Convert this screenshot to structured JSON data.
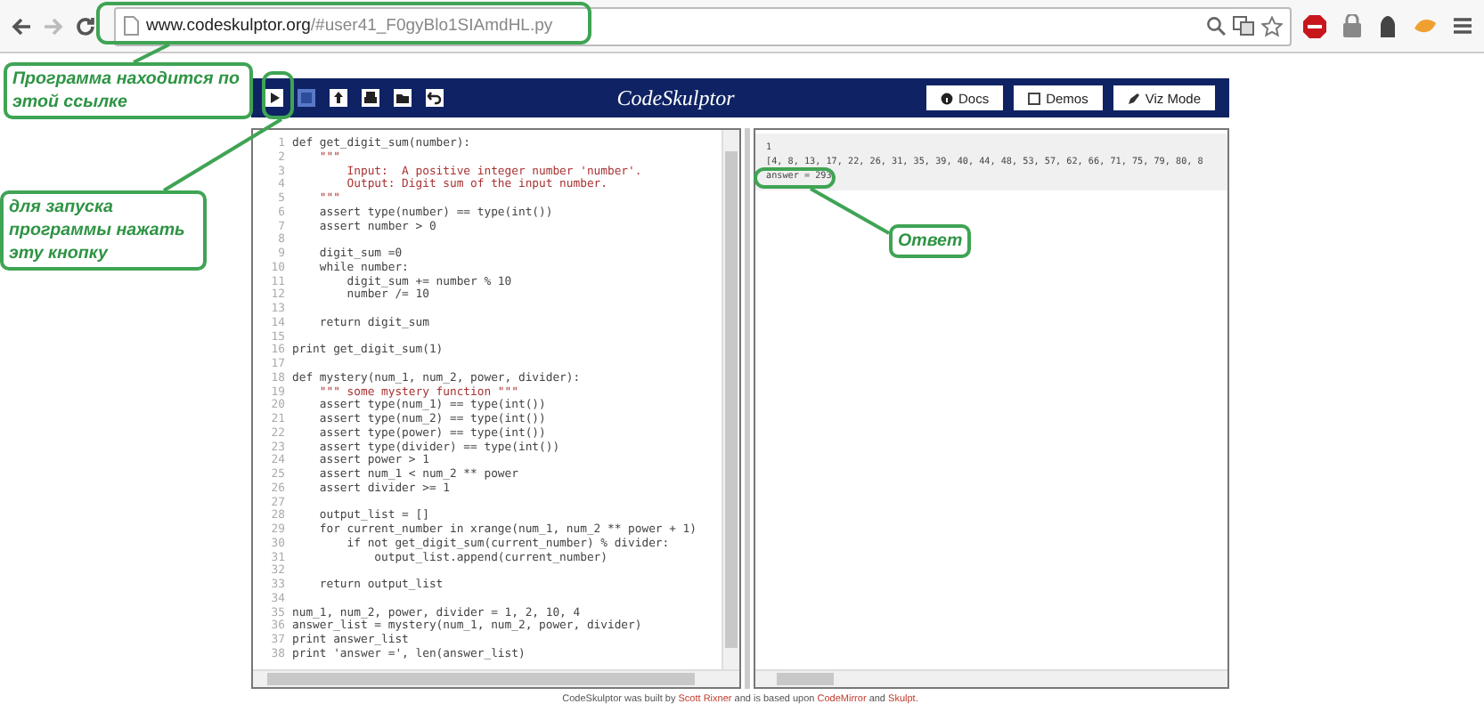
{
  "browser": {
    "url_host": "www.codeskulptor.org",
    "url_path": "/#user41_F0gyBlo1SIAmdHL.py",
    "back_disabled": false,
    "forward_disabled": true
  },
  "header": {
    "title": "CodeSkulptor",
    "tools": [
      {
        "kind": "run",
        "disabled": false
      },
      {
        "kind": "save",
        "disabled": true
      },
      {
        "kind": "upload",
        "disabled": false
      },
      {
        "kind": "print",
        "disabled": false
      },
      {
        "kind": "open",
        "disabled": false
      },
      {
        "kind": "reset",
        "disabled": false
      }
    ],
    "links": [
      {
        "kind": "docs",
        "label": "Docs"
      },
      {
        "kind": "demos",
        "label": "Demos"
      },
      {
        "kind": "viz",
        "label": "Viz Mode"
      }
    ]
  },
  "editor": {
    "lines": [
      {
        "number": "1",
        "text": "def get_digit_sum(number):",
        "kind": "code"
      },
      {
        "number": "2",
        "text": "    \"\"\"",
        "kind": "string"
      },
      {
        "number": "3",
        "text": "        Input:  A positive integer number 'number'.",
        "kind": "string"
      },
      {
        "number": "4",
        "text": "        Output: Digit sum of the input number.",
        "kind": "string"
      },
      {
        "number": "5",
        "text": "    \"\"\"",
        "kind": "string"
      },
      {
        "number": "6",
        "text": "    assert type(number) == type(int())",
        "kind": "code"
      },
      {
        "number": "7",
        "text": "    assert number > 0",
        "kind": "code"
      },
      {
        "number": "8"
      },
      {
        "number": "9",
        "text": "    digit_sum =0",
        "kind": "code"
      },
      {
        "number": "10",
        "text": "    while number:",
        "kind": "code"
      },
      {
        "number": "11",
        "text": "        digit_sum += number % 10",
        "kind": "code"
      },
      {
        "number": "12",
        "text": "        number /= 10",
        "kind": "code"
      },
      {
        "number": "13"
      },
      {
        "number": "14",
        "text": "    return digit_sum",
        "kind": "code"
      },
      {
        "number": "15"
      },
      {
        "number": "16",
        "text": "print get_digit_sum(1)",
        "kind": "code"
      },
      {
        "number": "17"
      },
      {
        "number": "18",
        "text": "def mystery(num_1, num_2, power, divider):",
        "kind": "code"
      },
      {
        "number": "19",
        "text": "    \"\"\" some mystery function \"\"\"",
        "kind": "string"
      },
      {
        "number": "20",
        "text": "    assert type(num_1) == type(int())",
        "kind": "code"
      },
      {
        "number": "21",
        "text": "    assert type(num_2) == type(int())",
        "kind": "code"
      },
      {
        "number": "22",
        "text": "    assert type(power) == type(int())",
        "kind": "code"
      },
      {
        "number": "23",
        "text": "    assert type(divider) == type(int())",
        "kind": "code"
      },
      {
        "number": "24",
        "text": "    assert power > 1",
        "kind": "code"
      },
      {
        "number": "25",
        "text": "    assert num_1 < num_2 ** power",
        "kind": "code"
      },
      {
        "number": "26",
        "text": "    assert divider >= 1",
        "kind": "code"
      },
      {
        "number": "27"
      },
      {
        "number": "28",
        "text": "    output_list = []",
        "kind": "code"
      },
      {
        "number": "29",
        "text": "    for current_number in xrange(num_1, num_2 ** power + 1)",
        "kind": "code"
      },
      {
        "number": "30",
        "text": "        if not get_digit_sum(current_number) % divider:",
        "kind": "code"
      },
      {
        "number": "31",
        "text": "            output_list.append(current_number)",
        "kind": "code"
      },
      {
        "number": "32"
      },
      {
        "number": "33",
        "text": "    return output_list",
        "kind": "code"
      },
      {
        "number": "34"
      },
      {
        "number": "35",
        "text": "num_1, num_2, power, divider = 1, 2, 10, 4",
        "kind": "code"
      },
      {
        "number": "36",
        "text": "answer_list = mystery(num_1, num_2, power, divider)",
        "kind": "code"
      },
      {
        "number": "37",
        "text": "print answer_list",
        "kind": "code"
      },
      {
        "number": "38",
        "text": "print 'answer =', len(answer_list)",
        "kind": "code"
      }
    ]
  },
  "output": {
    "lines": [
      "1",
      "[4, 8, 13, 17, 22, 26, 31, 35, 39, 40, 44, 48, 53, 57, 62, 66, 71, 75, 79, 80, 8",
      "answer = 293"
    ]
  },
  "footer": {
    "parts": [
      {
        "kind": "text",
        "text": "CodeSkulptor was built by"
      },
      {
        "kind": "link",
        "text": "Scott Rixner"
      },
      {
        "kind": "text",
        "text": "and is based upon"
      },
      {
        "kind": "link",
        "text": "CodeMirror"
      },
      {
        "kind": "text",
        "text": "and"
      },
      {
        "kind": "link",
        "text": "Skulpt."
      }
    ]
  },
  "annotations": [
    {
      "text": "Программа находится по этой ссылке"
    },
    {
      "text": "для запуска программы нажать эту кнопку"
    },
    {
      "text": "Ответ"
    }
  ]
}
